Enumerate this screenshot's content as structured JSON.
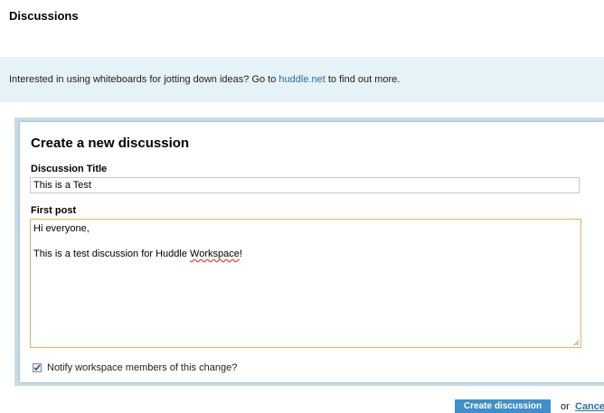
{
  "page": {
    "title": "Discussions"
  },
  "banner": {
    "text_before": "Interested in using whiteboards for jotting down ideas? Go to ",
    "link_text": "huddle.net",
    "text_after": " to find out more."
  },
  "form": {
    "heading": "Create a new discussion",
    "title_label": "Discussion Title",
    "title_value": "This is a Test",
    "post_label": "First post",
    "post_lines": {
      "line1": "Hi everyone,",
      "line3_before": "This is a test discussion for Huddle ",
      "line3_misspelled": "Workspace",
      "line3_after": "!"
    },
    "notify_label": "Notify workspace members of this change?",
    "notify_checked": true
  },
  "actions": {
    "create_label": "Create discussion",
    "or_text": "or",
    "cancel_label": "Cancel"
  },
  "colors": {
    "banner_bg": "#e5f2f8",
    "link": "#2a6fa8",
    "button": "#3f8fc9",
    "textarea_focus_border": "#e2b35c"
  }
}
